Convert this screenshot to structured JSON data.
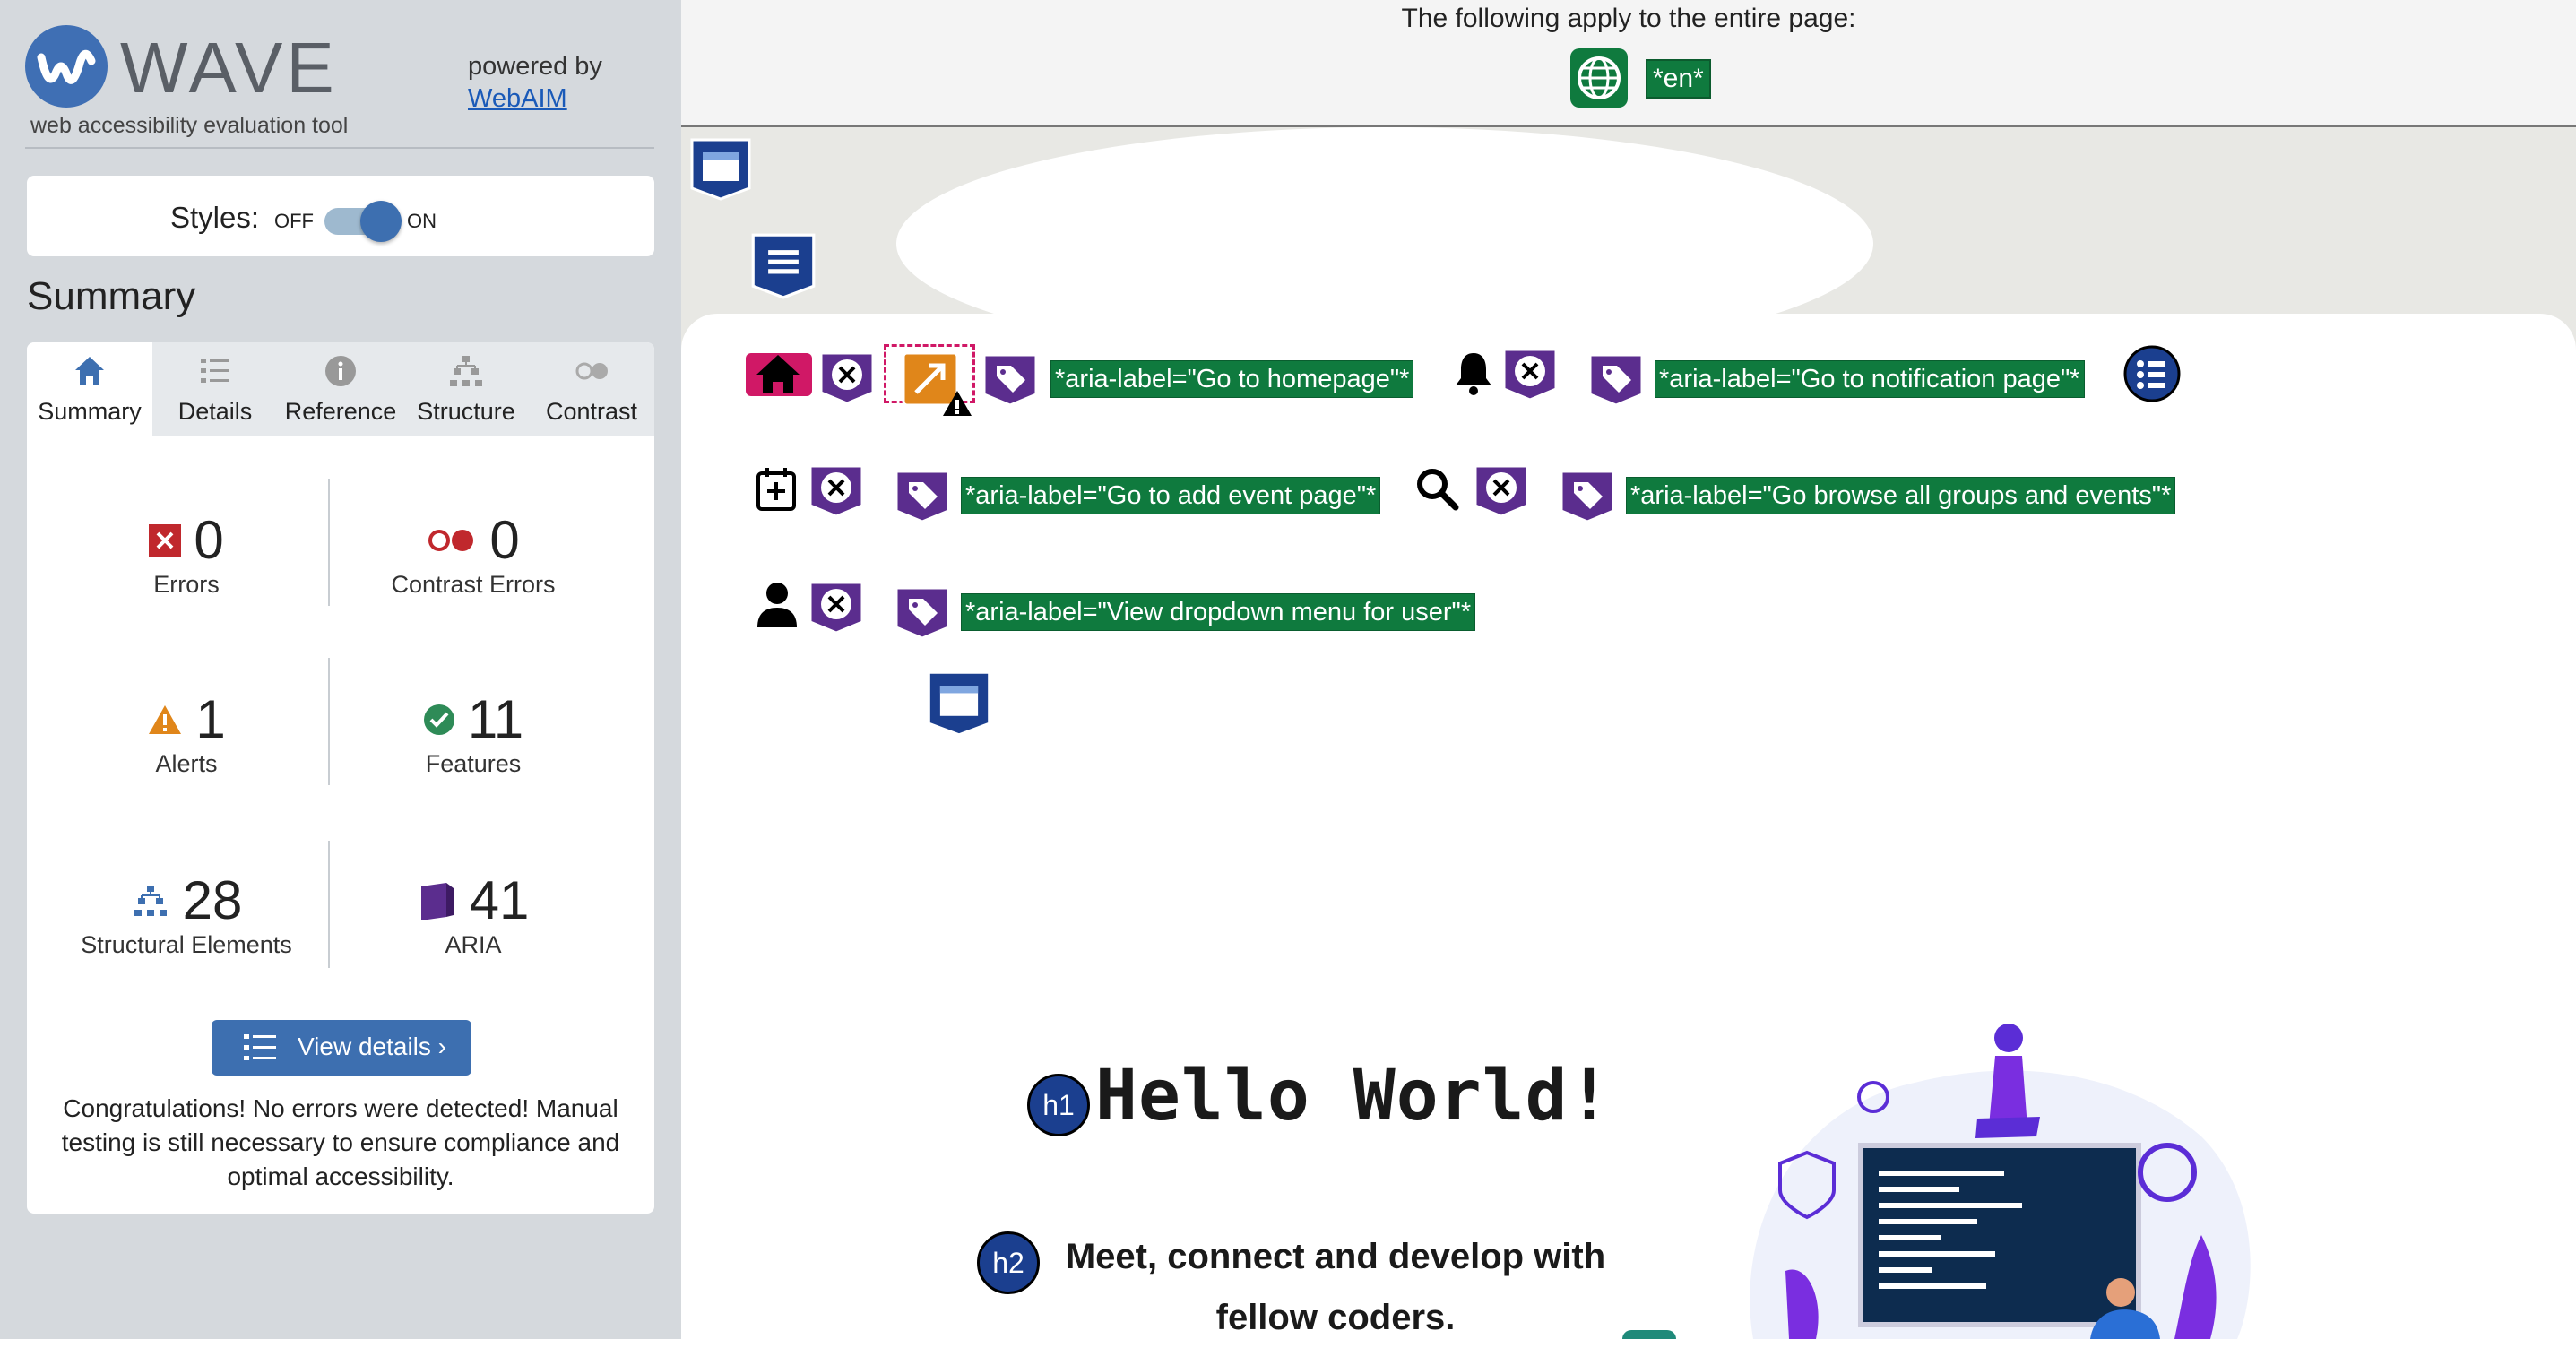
{
  "sidebar": {
    "brand": "WAVE",
    "tagline": "web accessibility evaluation tool",
    "powered_by": "powered by",
    "powered_link": "WebAIM",
    "styles": {
      "label": "Styles:",
      "off": "OFF",
      "on": "ON",
      "state": "on"
    },
    "summary_heading": "Summary",
    "tabs": [
      {
        "label": "Summary",
        "icon": "home-icon",
        "active": true
      },
      {
        "label": "Details",
        "icon": "list-icon",
        "active": false
      },
      {
        "label": "Reference",
        "icon": "info-icon",
        "active": false
      },
      {
        "label": "Structure",
        "icon": "structure-icon",
        "active": false
      },
      {
        "label": "Contrast",
        "icon": "contrast-icon",
        "active": false
      }
    ],
    "stats": {
      "errors": {
        "value": "0",
        "label": "Errors"
      },
      "contrast_errors": {
        "value": "0",
        "label": "Contrast Errors"
      },
      "alerts": {
        "value": "1",
        "label": "Alerts"
      },
      "features": {
        "value": "11",
        "label": "Features"
      },
      "structural": {
        "value": "28",
        "label": "Structural Elements"
      },
      "aria": {
        "value": "41",
        "label": "ARIA"
      }
    },
    "view_details": "View details ›",
    "congrats": "Congratulations! No errors were detected! Manual testing is still necessary to ensure compliance and optimal accessibility."
  },
  "content": {
    "apply_text": "The following apply to the entire page:",
    "lang_badge": "*en*",
    "aria_labels": {
      "home": "*aria-label=\"Go to homepage\"*",
      "notification": "*aria-label=\"Go to notification page\"*",
      "add_event": "*aria-label=\"Go to add event page\"*",
      "browse": "*aria-label=\"Go browse all groups and events\"*",
      "user_menu": "*aria-label=\"View dropdown menu for user\"*"
    },
    "h1_badge": "h1",
    "h1": "Hello World!",
    "h2_badge": "h2",
    "h2": "Meet, connect and develop with fellow coders."
  },
  "colors": {
    "wave_blue": "#3d6fb0",
    "aria_green": "#0f7a3e",
    "aria_purple": "#5b2d8e",
    "error_red": "#c0282d",
    "alert_orange": "#e0861a",
    "feature_green": "#2e8b57",
    "structure_navy": "#1b3f8f"
  }
}
